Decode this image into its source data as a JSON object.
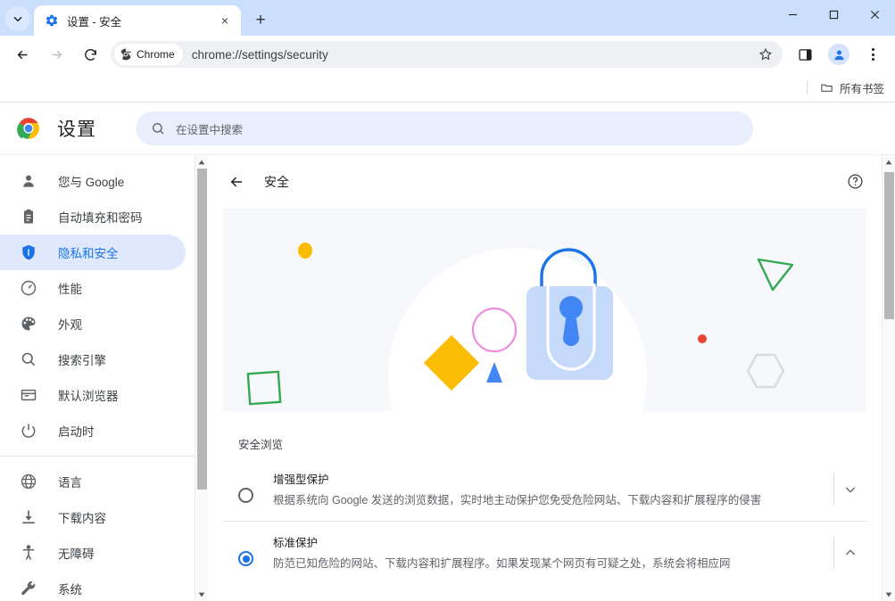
{
  "window": {
    "tab": {
      "title": "设置 - 安全",
      "favicon": "gear-icon",
      "close": "×"
    },
    "new_tab_label": "+",
    "tab_search": "chevron-down-icon",
    "controls": {
      "minimize": "minimize-icon",
      "maximize": "maximize-icon",
      "close": "close-icon"
    }
  },
  "toolbar": {
    "back": "back-arrow-icon",
    "forward": "forward-arrow-icon",
    "reload": "reload-icon",
    "chip_label": "Chrome",
    "url": "chrome://settings/security",
    "bookmark_star": "star-icon",
    "side_panel": "side-panel-icon",
    "profile": "profile-avatar-icon",
    "menu": "three-dot-menu-icon"
  },
  "bookmarks_bar": {
    "all_bookmarks_label": "所有书签",
    "folder_icon": "folder-icon"
  },
  "settings_header": {
    "logo": "chrome-logo",
    "title": "设置",
    "search_placeholder": "在设置中搜索",
    "search_icon": "search-icon"
  },
  "sidebar": {
    "groups": [
      {
        "items": [
          {
            "label": "您与 Google",
            "icon": "person-icon",
            "active": false
          },
          {
            "label": "自动填充和密码",
            "icon": "clipboard-icon",
            "active": false
          },
          {
            "label": "隐私和安全",
            "icon": "shield-icon",
            "active": true
          },
          {
            "label": "性能",
            "icon": "speedometer-icon",
            "active": false
          },
          {
            "label": "外观",
            "icon": "palette-icon",
            "active": false
          },
          {
            "label": "搜索引擎",
            "icon": "search-icon",
            "active": false
          },
          {
            "label": "默认浏览器",
            "icon": "browser-window-icon",
            "active": false
          },
          {
            "label": "启动时",
            "icon": "power-icon",
            "active": false
          }
        ]
      },
      {
        "items": [
          {
            "label": "语言",
            "icon": "globe-icon",
            "active": false
          },
          {
            "label": "下载内容",
            "icon": "download-icon",
            "active": false
          },
          {
            "label": "无障碍",
            "icon": "accessibility-icon",
            "active": false
          },
          {
            "label": "系统",
            "icon": "wrench-icon",
            "active": false
          }
        ]
      }
    ]
  },
  "page": {
    "back_icon": "back-arrow-icon",
    "title": "安全",
    "help_icon": "help-circle-icon",
    "hero_illustration": "security-lock-illustration",
    "section_title": "安全浏览",
    "options": [
      {
        "name": "增强型保护",
        "desc": "根据系统向 Google 发送的浏览数据，实时地主动保护您免受危险网站、下载内容和扩展程序的侵害",
        "selected": false,
        "expander": "chevron-down-icon"
      },
      {
        "name": "标准保护",
        "desc": "防范已知危险的网站、下载内容和扩展程序。如果发现某个网页有可疑之处，系统会将相应网",
        "selected": true,
        "expander": "chevron-up-icon"
      }
    ]
  },
  "colors": {
    "accent_blue": "#1a73e8",
    "tabstrip_blue": "#cadffc",
    "active_nav_bg": "#dfe8fc",
    "hero_bg": "#f6f8fb",
    "lock_body": "#c5dafb",
    "lock_blue": "#4285f4",
    "shape_yellow": "#fbbc04",
    "shape_green": "#34a853",
    "shape_red": "#ea4335",
    "shape_pink": "#f08ce0",
    "shape_gray": "#dadce0"
  }
}
